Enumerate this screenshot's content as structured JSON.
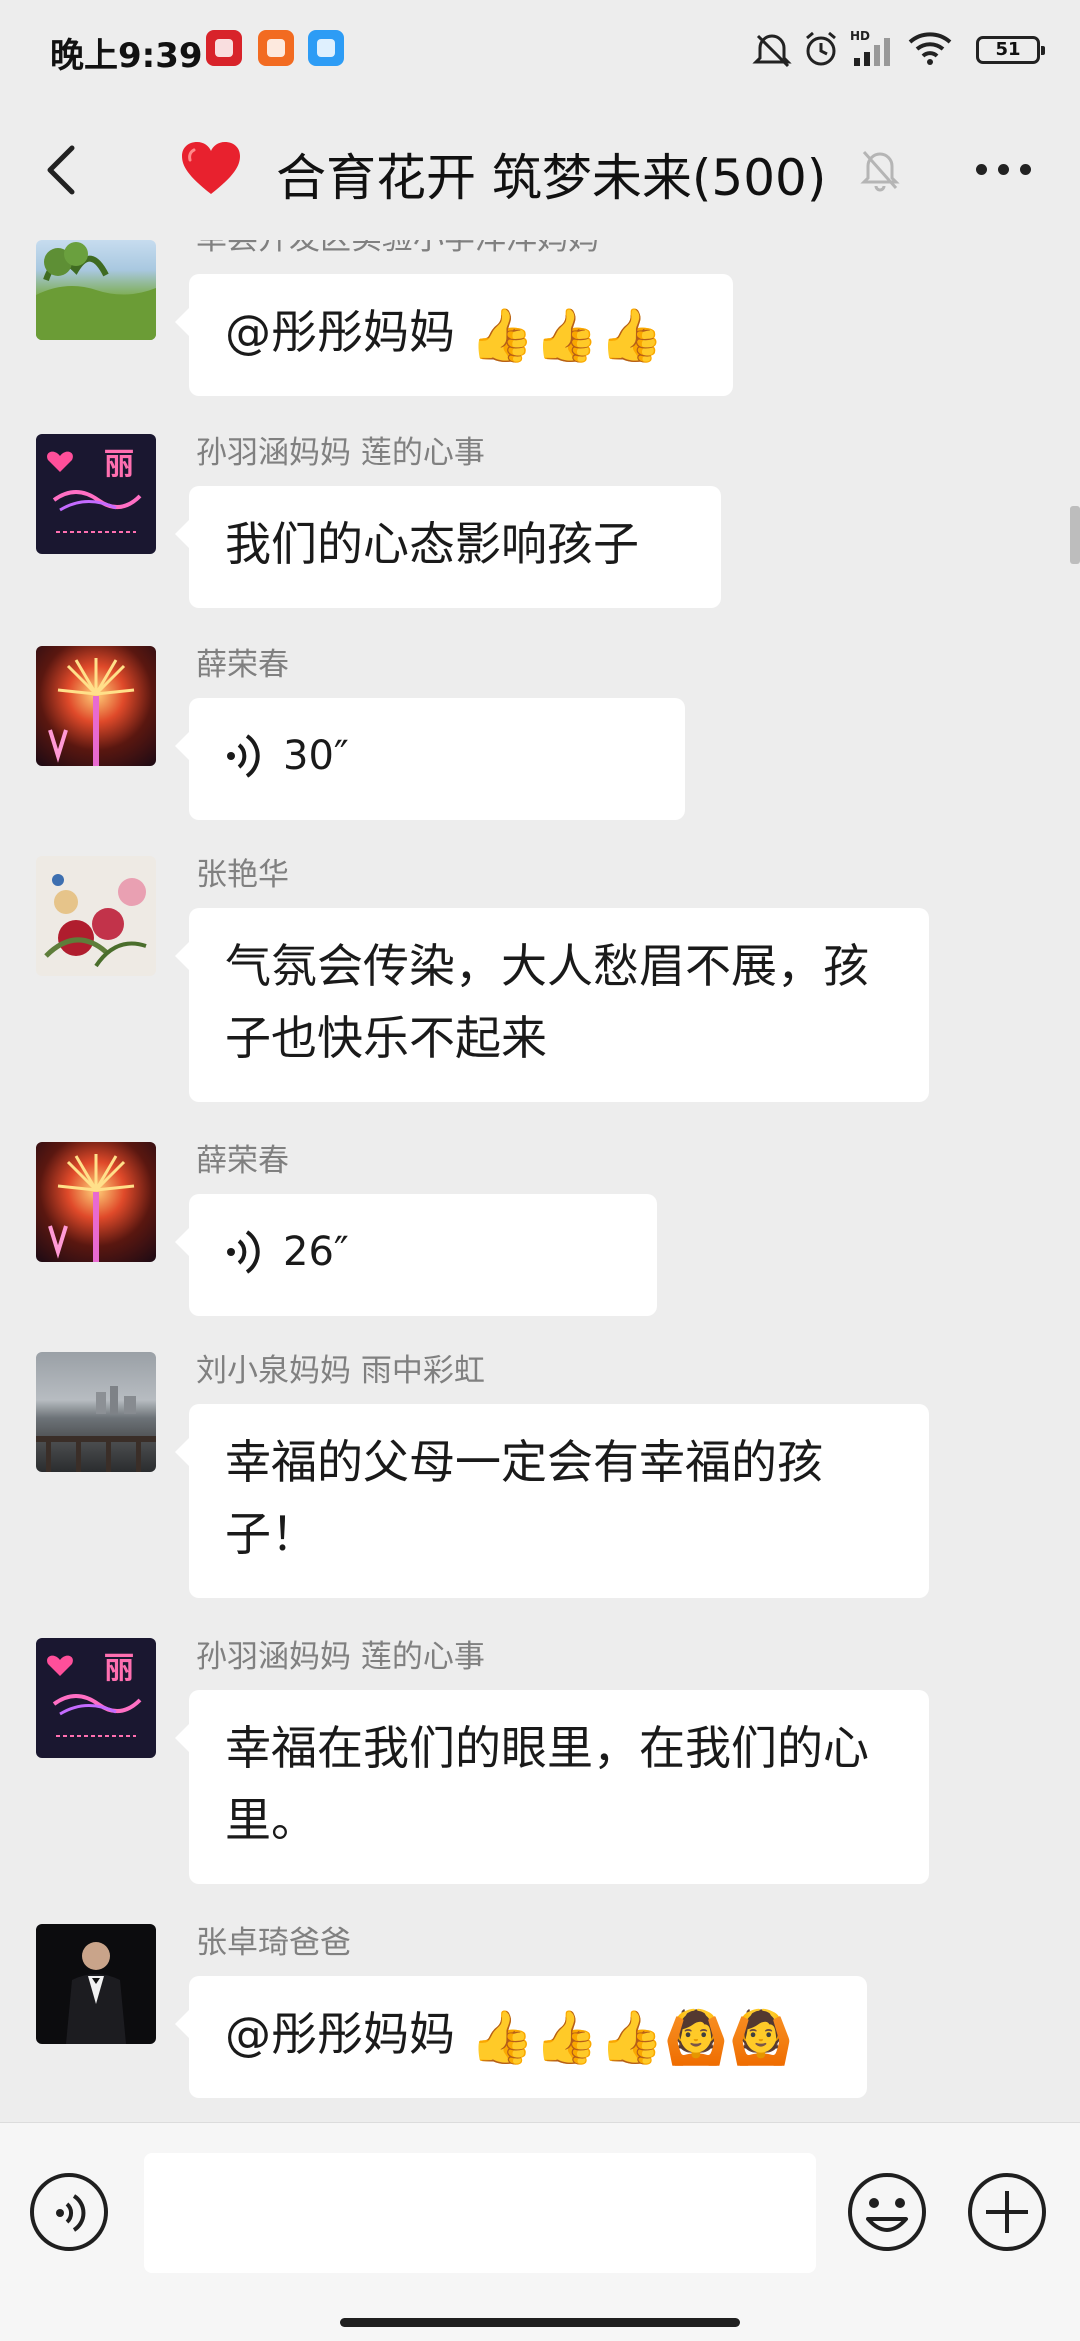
{
  "status_bar": {
    "time": "晚上9:39",
    "battery": "51",
    "network_label": "HD"
  },
  "header": {
    "title": "合育花开 筑梦未来(500)"
  },
  "messages": [
    {
      "sender": "单县开发区实验小学洋洋妈妈",
      "text": "@彤彤妈妈",
      "emoji": "👍👍👍",
      "avatar": "landscape"
    },
    {
      "sender": "孙羽涵妈妈  莲的心事",
      "text": "我们的心态影响孩子",
      "avatar": "neon-text"
    },
    {
      "sender": "薛荣春",
      "voice": "30″",
      "avatar": "fireworks"
    },
    {
      "sender": "张艳华",
      "text": "气氛会传染，大人愁眉不展，孩子也快乐不起来",
      "avatar": "peony"
    },
    {
      "sender": "薛荣春",
      "voice": "26″",
      "avatar": "fireworks"
    },
    {
      "sender": "刘小泉妈妈  雨中彩虹",
      "text": "幸福的父母一定会有幸福的孩子！",
      "avatar": "lake"
    },
    {
      "sender": "孙羽涵妈妈  莲的心事",
      "text": "幸福在我们的眼里，在我们的心里。",
      "avatar": "neon-text"
    },
    {
      "sender": "张卓琦爸爸",
      "text": "@彤彤妈妈",
      "emoji": "👍👍👍🙆🙆",
      "avatar": "man-suit"
    }
  ],
  "avatar_text": {
    "neon": "丽"
  },
  "input": {
    "placeholder": ""
  },
  "colors": {
    "background": "#ededed",
    "bubble": "#ffffff",
    "sender_name": "#808080",
    "header_heart": "#e8212e"
  }
}
